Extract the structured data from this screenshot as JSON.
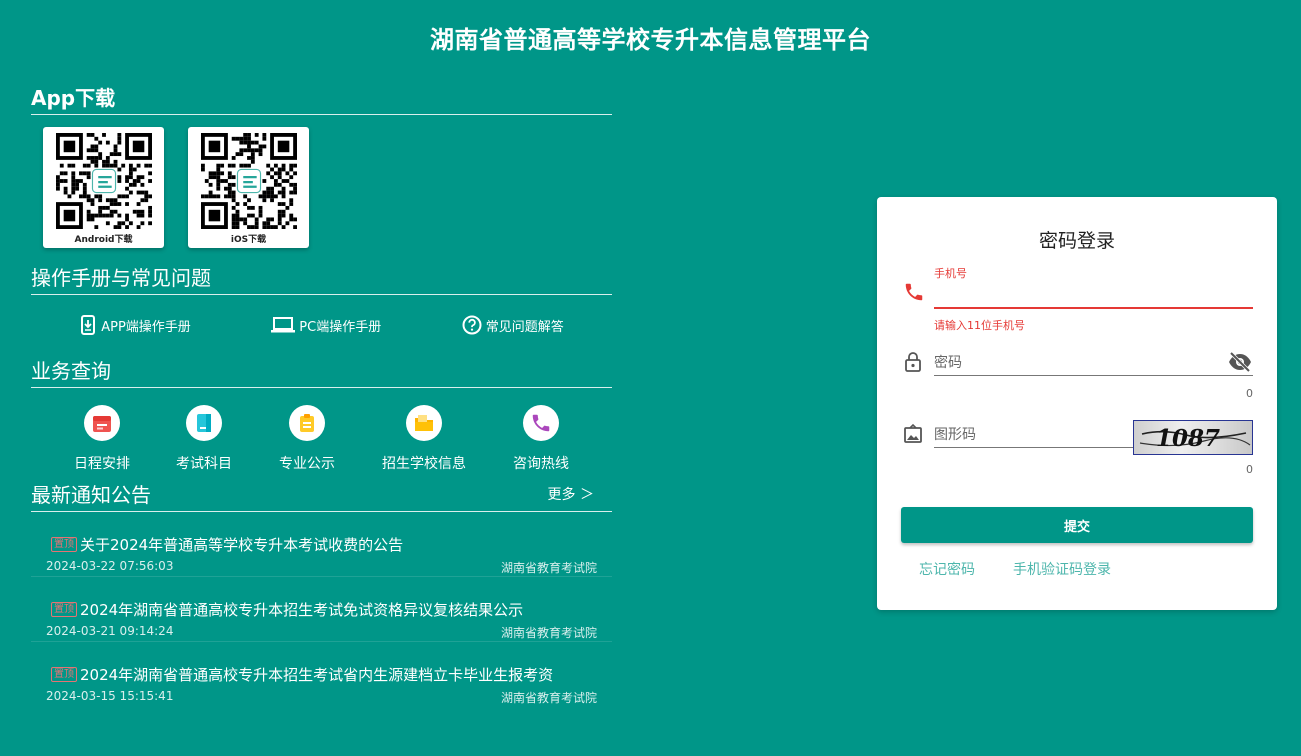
{
  "header": {
    "title": "湖南省普通高等学校专升本信息管理平台"
  },
  "app_download": {
    "title": "App下载",
    "items": [
      {
        "label": "Android下载",
        "icon": "qr-code-icon"
      },
      {
        "label": "iOS下载",
        "icon": "qr-code-icon"
      }
    ]
  },
  "manuals": {
    "title": "操作手册与常见问题",
    "items": [
      {
        "label": "APP端操作手册",
        "icon": "phone-download-icon"
      },
      {
        "label": "PC端操作手册",
        "icon": "laptop-icon"
      },
      {
        "label": "常见问题解答",
        "icon": "question-circle-icon"
      }
    ]
  },
  "business": {
    "title": "业务查询",
    "items": [
      {
        "label": "日程安排",
        "icon": "calendar-icon",
        "color": "#ef5350"
      },
      {
        "label": "考试科目",
        "icon": "book-icon",
        "color": "#26c6da"
      },
      {
        "label": "专业公示",
        "icon": "clipboard-icon",
        "color": "#ffca28"
      },
      {
        "label": "招生学校信息",
        "icon": "folder-icon",
        "color": "#ffb300"
      },
      {
        "label": "咨询热线",
        "icon": "phone-icon",
        "color": "#ab47bc"
      }
    ]
  },
  "notices": {
    "title": "最新通知公告",
    "more": "更多 ＞",
    "items": [
      {
        "badge": "置顶",
        "title": "关于2024年普通高等学校专升本考试收费的公告",
        "date": "2024-03-22 07:56:03",
        "source": "湖南省教育考试院"
      },
      {
        "badge": "置顶",
        "title": "2024年湖南省普通高校专升本招生考试免试资格异议复核结果公示",
        "date": "2024-03-21 09:14:24",
        "source": "湖南省教育考试院"
      },
      {
        "badge": "置顶",
        "title": "2024年湖南省普通高校专升本招生考试省内生源建档立卡毕业生报考资",
        "date": "2024-03-15 15:15:41",
        "source": "湖南省教育考试院"
      }
    ]
  },
  "login": {
    "title": "密码登录",
    "phone": {
      "label": "手机号",
      "value": "",
      "error": "请输入11位手机号"
    },
    "password": {
      "placeholder": "密码",
      "counter": "0"
    },
    "captcha": {
      "placeholder": "图形码",
      "counter": "0",
      "image_text": "1087"
    },
    "submit": "提交",
    "links": {
      "forgot": "忘记密码",
      "sms_login": "手机验证码登录"
    }
  },
  "colors": {
    "primary": "#009688",
    "error": "#e53935",
    "link": "#4db6ac"
  }
}
